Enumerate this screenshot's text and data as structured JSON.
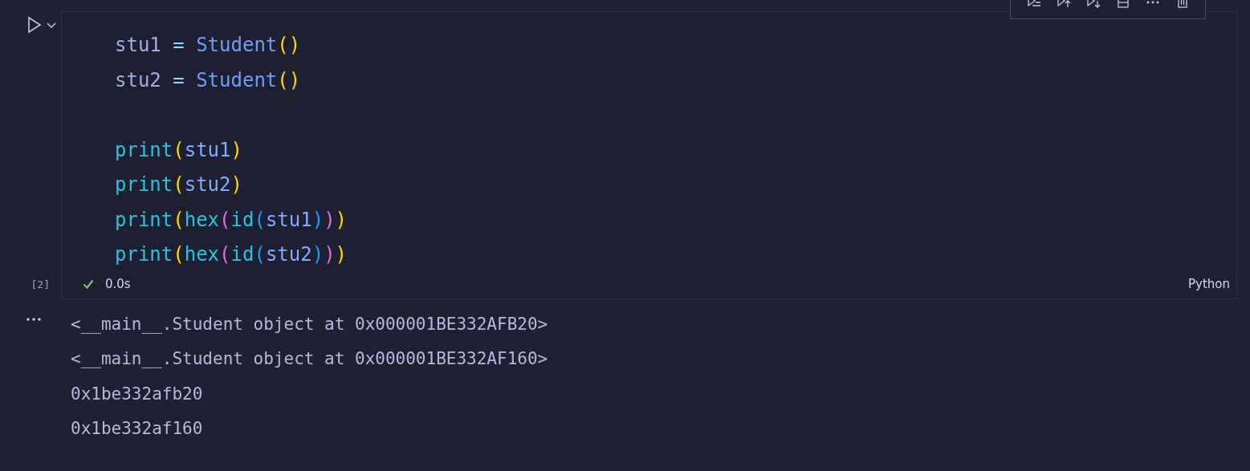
{
  "cell": {
    "execution_count": "[2]",
    "succeeded": true,
    "duration": "0.0s",
    "language": "Python",
    "code_lines": [
      {
        "kind": "code",
        "tokens": [
          {
            "text": "stu1",
            "kind": "var"
          },
          {
            "text": " = ",
            "kind": "op"
          },
          {
            "text": "Student",
            "kind": "class"
          },
          {
            "text": "()",
            "kind": "bracket1"
          }
        ]
      },
      {
        "kind": "code",
        "tokens": [
          {
            "text": "stu2",
            "kind": "var"
          },
          {
            "text": " = ",
            "kind": "op"
          },
          {
            "text": "Student",
            "kind": "class"
          },
          {
            "text": "()",
            "kind": "bracket1"
          }
        ]
      },
      {
        "kind": "blank"
      },
      {
        "kind": "code",
        "tokens": [
          {
            "text": "print",
            "kind": "func"
          },
          {
            "text": "(",
            "kind": "bracket1"
          },
          {
            "text": "stu1",
            "kind": "arg"
          },
          {
            "text": ")",
            "kind": "bracket1"
          }
        ]
      },
      {
        "kind": "code",
        "tokens": [
          {
            "text": "print",
            "kind": "func"
          },
          {
            "text": "(",
            "kind": "bracket1"
          },
          {
            "text": "stu2",
            "kind": "arg"
          },
          {
            "text": ")",
            "kind": "bracket1"
          }
        ]
      },
      {
        "kind": "code",
        "tokens": [
          {
            "text": "print",
            "kind": "func"
          },
          {
            "text": "(",
            "kind": "bracket1"
          },
          {
            "text": "hex",
            "kind": "func"
          },
          {
            "text": "(",
            "kind": "bracket2"
          },
          {
            "text": "id",
            "kind": "func"
          },
          {
            "text": "(",
            "kind": "bracket3"
          },
          {
            "text": "stu1",
            "kind": "arg"
          },
          {
            "text": ")",
            "kind": "bracket3"
          },
          {
            "text": ")",
            "kind": "bracket2"
          },
          {
            "text": ")",
            "kind": "bracket1"
          }
        ]
      },
      {
        "kind": "code",
        "tokens": [
          {
            "text": "print",
            "kind": "func"
          },
          {
            "text": "(",
            "kind": "bracket1"
          },
          {
            "text": "hex",
            "kind": "func"
          },
          {
            "text": "(",
            "kind": "bracket2"
          },
          {
            "text": "id",
            "kind": "func"
          },
          {
            "text": "(",
            "kind": "bracket3"
          },
          {
            "text": "stu2",
            "kind": "arg"
          },
          {
            "text": ")",
            "kind": "bracket3"
          },
          {
            "text": ")",
            "kind": "bracket2"
          },
          {
            "text": ")",
            "kind": "bracket1"
          }
        ]
      }
    ],
    "output_lines": [
      "<__main__.Student object at 0x000001BE332AFB20>",
      "<__main__.Student object at 0x000001BE332AF160>",
      "0x1be332afb20",
      "0x1be332af160"
    ]
  }
}
